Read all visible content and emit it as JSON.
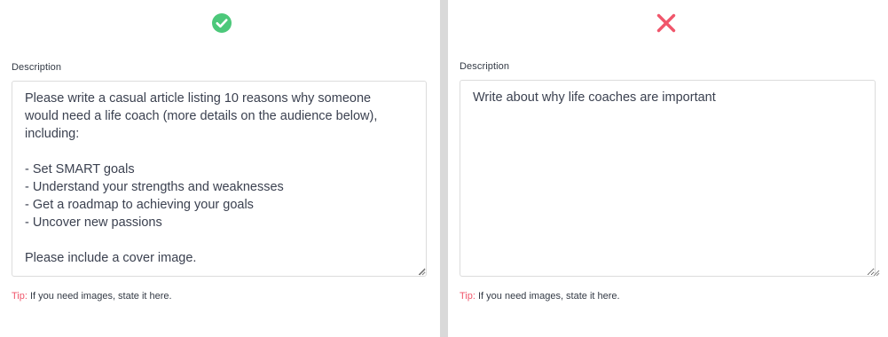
{
  "good_example": {
    "status_icon": "check-circle-icon",
    "status_color": "#4cc87a",
    "field_label": "Description",
    "description_value": "Please write a casual article listing 10 reasons why someone\nwould need a life coach (more details on the audience below),\nincluding:\n\n- Set SMART goals\n- Understand your strengths and weaknesses\n- Get a roadmap to achieving your goals\n- Uncover new passions\n\nPlease include a cover image.",
    "tip_label": "Tip:",
    "tip_text": " If you need images, state it here."
  },
  "bad_example": {
    "status_icon": "cross-icon",
    "status_color": "#f0566b",
    "field_label": "Description",
    "description_value": "Write about why life coaches are important",
    "tip_label": "Tip:",
    "tip_text": " If you need images, state it here."
  }
}
